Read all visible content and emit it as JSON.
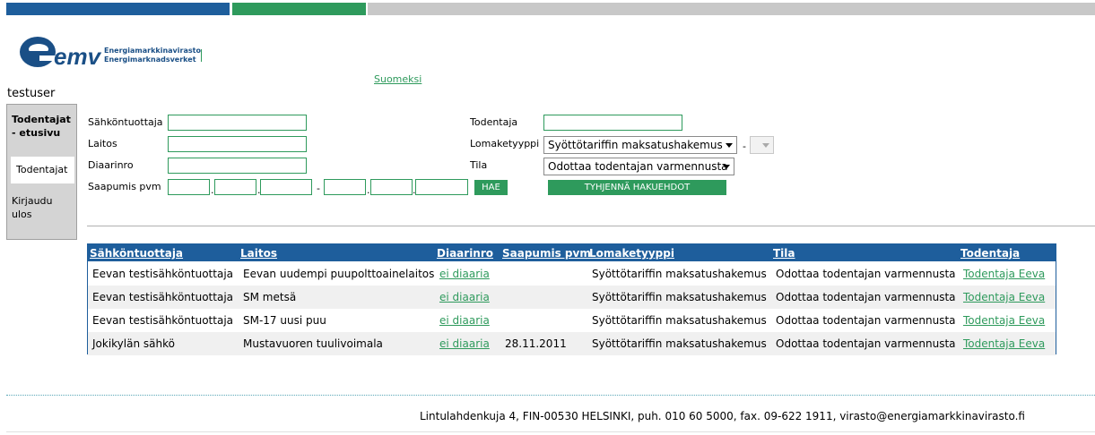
{
  "logo": {
    "mark": "emv",
    "line1": "Energiamarkkinavirasto",
    "line2": "Energimarknadsverket"
  },
  "language_link": "Suomeksi",
  "user": "testuser",
  "sidebar": {
    "home": "Todentajat - etusivu",
    "todentajat": "Todentajat",
    "logout": "Kirjaudu ulos"
  },
  "search": {
    "sahkontuottaja_label": "Sähköntuottaja",
    "laitos_label": "Laitos",
    "diaarinro_label": "Diaarinro",
    "saapumis_label": "Saapumis pvm",
    "todentaja_label": "Todentaja",
    "lomaketyyppi_label": "Lomaketyyppi",
    "lomaketyyppi_value": "Syöttötariffin maksatushakemus",
    "dash": "-",
    "tila_label": "Tila",
    "tila_value": "Odottaa todentajan varmennusta",
    "date_sep": "-",
    "hae": "HAE",
    "clear": "TYHJENNÄ HAKUEHDOT"
  },
  "table": {
    "headers": [
      "Sähköntuottaja",
      "Laitos",
      "Diaarinro",
      "Saapumis pvm",
      "Lomaketyyppi",
      "Tila",
      "Todentaja"
    ],
    "rows": [
      [
        "Eevan testisähköntuottaja",
        "Eevan uudempi puupolttoainelaitos",
        "ei diaaria",
        "",
        "Syöttötariffin maksatushakemus",
        "Odottaa todentajan varmennusta",
        "Todentaja Eeva"
      ],
      [
        "Eevan testisähköntuottaja",
        "SM metsä",
        "ei diaaria",
        "",
        "Syöttötariffin maksatushakemus",
        "Odottaa todentajan varmennusta",
        "Todentaja Eeva"
      ],
      [
        "Eevan testisähköntuottaja",
        "SM-17 uusi puu",
        "ei diaaria",
        "",
        "Syöttötariffin maksatushakemus",
        "Odottaa todentajan varmennusta",
        "Todentaja Eeva"
      ],
      [
        "Jokikylän sähkö",
        "Mustavuoren tuulivoimala",
        "ei diaaria",
        "28.11.2011",
        "Syöttötariffin maksatushakemus",
        "Odottaa todentajan varmennusta",
        "Todentaja Eeva"
      ]
    ]
  },
  "footer": "Lintulahdenkuja 4, FIN-00530 HELSINKI, puh. 010 60 5000, fax. 09-622 1911, virasto@energiamarkkinavirasto.fi",
  "colors": {
    "blue": "#1e5e9c",
    "green": "#2e9a5c",
    "gray": "#c8c8c8"
  }
}
